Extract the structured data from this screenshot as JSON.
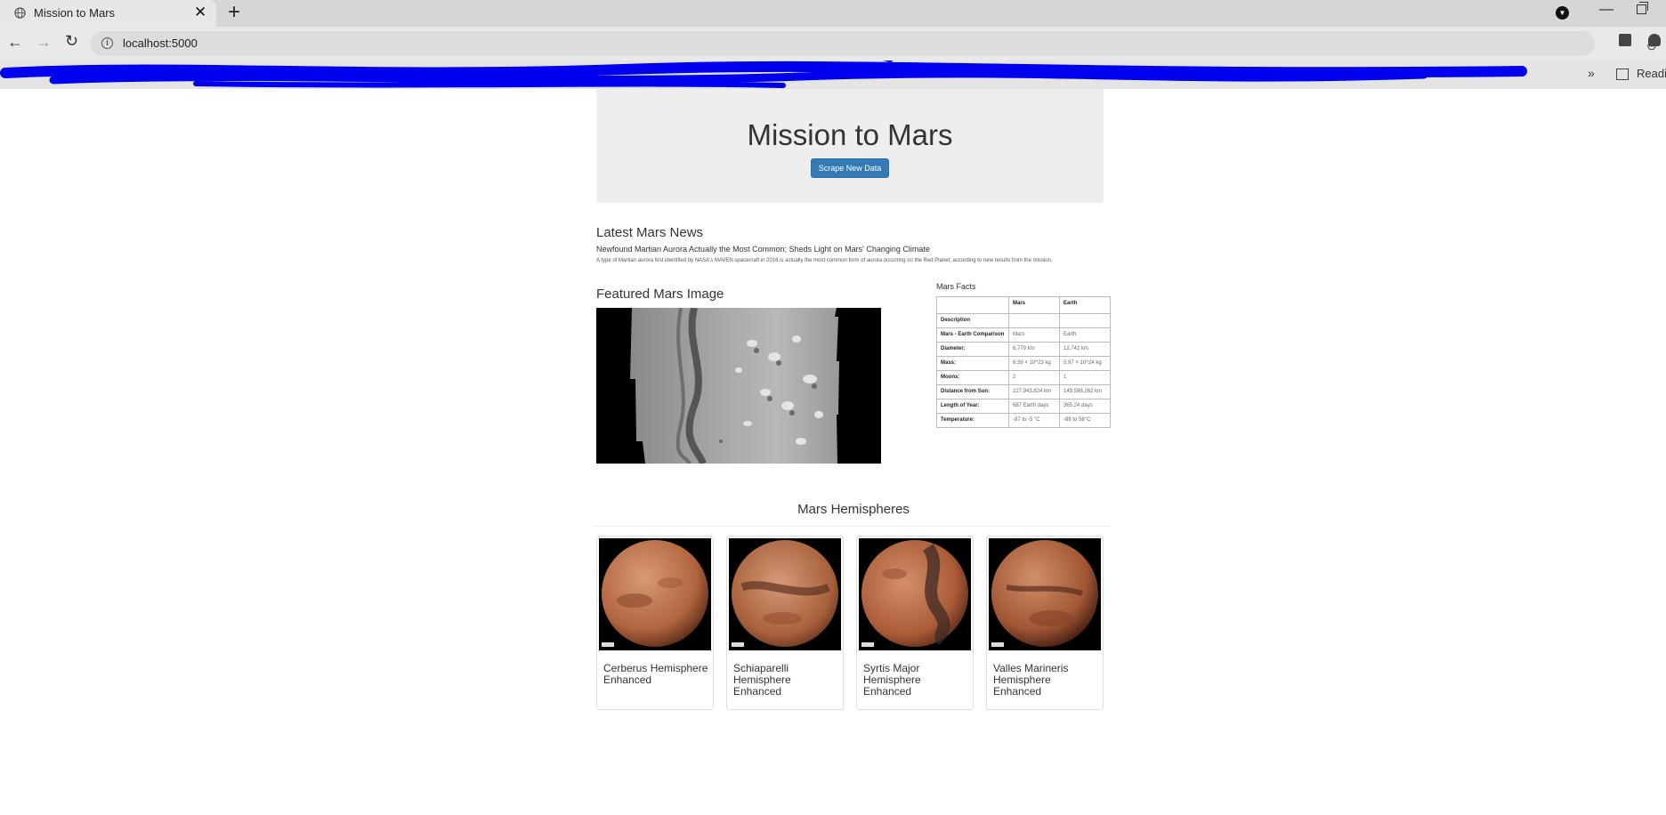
{
  "browser": {
    "tab_title": "Mission to Mars",
    "url": "localhost:5000",
    "bookmarks_more": "»",
    "reading_list_label": "Readin"
  },
  "jumbotron": {
    "title": "Mission to Mars",
    "button_label": "Scrape New Data",
    "button_color": "#337ab7"
  },
  "news": {
    "heading": "Latest Mars News",
    "title": "Newfound Martian Aurora Actually the Most Common; Sheds Light on Mars' Changing Climate",
    "teaser": "A type of Martian aurora first identified by NASA's MAVEN spacecraft in 2016 is actually the most common form of aurora occurring on the Red Planet, according to new results from the mission."
  },
  "featured": {
    "heading": "Featured Mars Image"
  },
  "facts": {
    "heading": "Mars Facts",
    "columns": [
      "",
      "Mars",
      "Earth"
    ],
    "rows": [
      {
        "label": "Description",
        "mars": "",
        "earth": ""
      },
      {
        "label": "Mars - Earth Comparison",
        "mars": "Mars",
        "earth": "Earth"
      },
      {
        "label": "Diameter:",
        "mars": "6,779 km",
        "earth": "12,742 km"
      },
      {
        "label": "Mass:",
        "mars": "6.39 × 10^23 kg",
        "earth": "5.97 × 10^24 kg"
      },
      {
        "label": "Moons:",
        "mars": "2",
        "earth": "1"
      },
      {
        "label": "Distance from Sun:",
        "mars": "227,943,824 km",
        "earth": "149,598,262 km"
      },
      {
        "label": "Length of Year:",
        "mars": "687 Earth days",
        "earth": "365.24 days"
      },
      {
        "label": "Temperature:",
        "mars": "-87 to -5 °C",
        "earth": "-88 to 58°C"
      }
    ]
  },
  "hemispheres": {
    "heading": "Mars Hemispheres",
    "items": [
      {
        "title": "Cerberus Hemisphere Enhanced"
      },
      {
        "title": "Schiaparelli Hemisphere Enhanced"
      },
      {
        "title": "Syrtis Major Hemisphere Enhanced"
      },
      {
        "title": "Valles Marineris Hemisphere Enhanced"
      }
    ]
  }
}
